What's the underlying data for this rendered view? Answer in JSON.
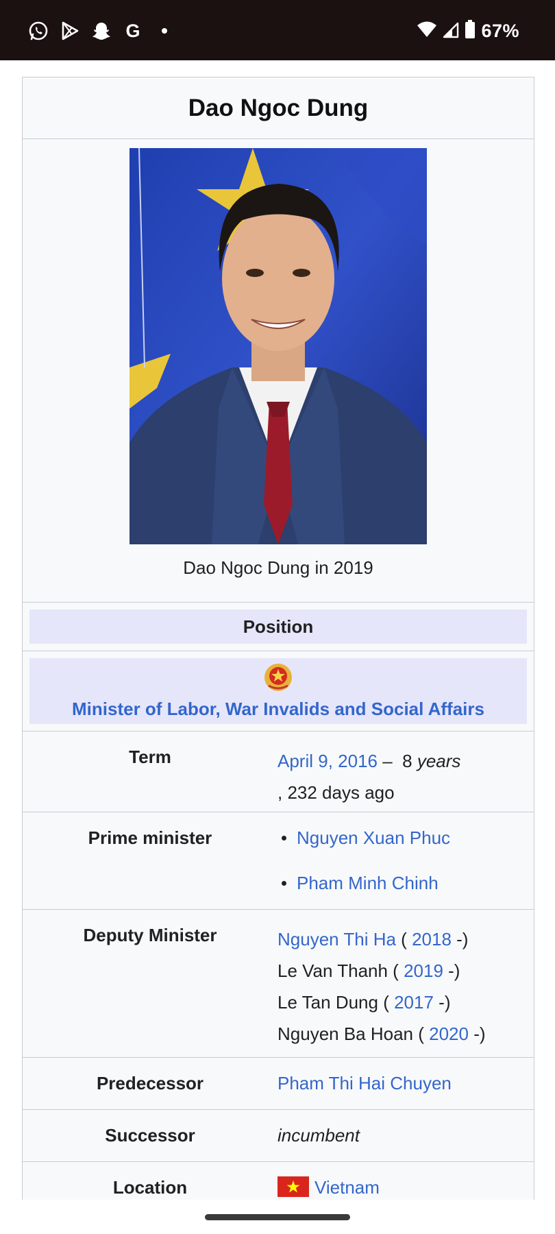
{
  "status_bar": {
    "notification_icons": [
      "whatsapp-icon",
      "play-store-icon",
      "snapchat-icon",
      "google-icon",
      "dot-icon"
    ],
    "google_letter": "G",
    "battery_percent": "67%"
  },
  "infobox": {
    "title": "Dao Ngoc Dung",
    "image_caption": "Dao Ngoc Dung in 2019",
    "section_header": "Position",
    "office_title": "Minister of Labor, War Invalids and Social Affairs",
    "rows": {
      "term": {
        "label": "Term",
        "date_link": "April 9, 2016",
        "dash": " –  8 ",
        "years": "years",
        "rest": ", 232 days ago"
      },
      "prime_minister": {
        "label": "Prime minister",
        "items": [
          "Nguyen Xuan Phuc",
          "Pham Minh Chinh"
        ]
      },
      "deputy_minister": {
        "label": "Deputy Minister",
        "entries": [
          {
            "name": "Nguyen Thi Ha",
            "name_is_link": true,
            "year": "2018"
          },
          {
            "name": "Le Van Thanh",
            "name_is_link": false,
            "year": "2019"
          },
          {
            "name": "Le Tan Dung",
            "name_is_link": false,
            "year": "2017"
          },
          {
            "name": "Nguyen Ba Hoan",
            "name_is_link": false,
            "year": "2020"
          }
        ],
        "open": " ( ",
        "close": " -)"
      },
      "predecessor": {
        "label": "Predecessor",
        "value": "Pham Thi Hai Chuyen"
      },
      "successor": {
        "label": "Successor",
        "value": "incumbent"
      },
      "location": {
        "label": "Location",
        "value": "Vietnam"
      }
    }
  },
  "colors": {
    "link": "#3366cc",
    "header_bg": "#e6e6fa",
    "status_bar_bg": "#1c1111"
  }
}
